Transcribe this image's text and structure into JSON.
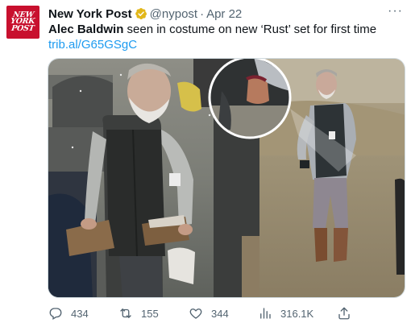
{
  "author": {
    "name": "New York Post",
    "handle": "@nypost",
    "separator": "·",
    "date": "Apr 22",
    "avatar_logo_lines": [
      "NEW",
      "YORK",
      "POST"
    ],
    "avatar_color": "#c8102e",
    "verified_color": "#e2b719"
  },
  "tweet": {
    "bold_name": "Alec Baldwin",
    "text_rest": " seen in costume on new ‘Rust’ set for first time",
    "link": "trib.al/G65GSgC"
  },
  "media": {
    "description_icon": "photo-collage"
  },
  "actions": {
    "reply_count": "434",
    "retweet_count": "155",
    "like_count": "344",
    "views_count": "316.1K"
  },
  "colors": {
    "text": "#0f1419",
    "secondary": "#536471",
    "link": "#1d9bf0"
  },
  "more_icon": "more-horizontal-icon"
}
